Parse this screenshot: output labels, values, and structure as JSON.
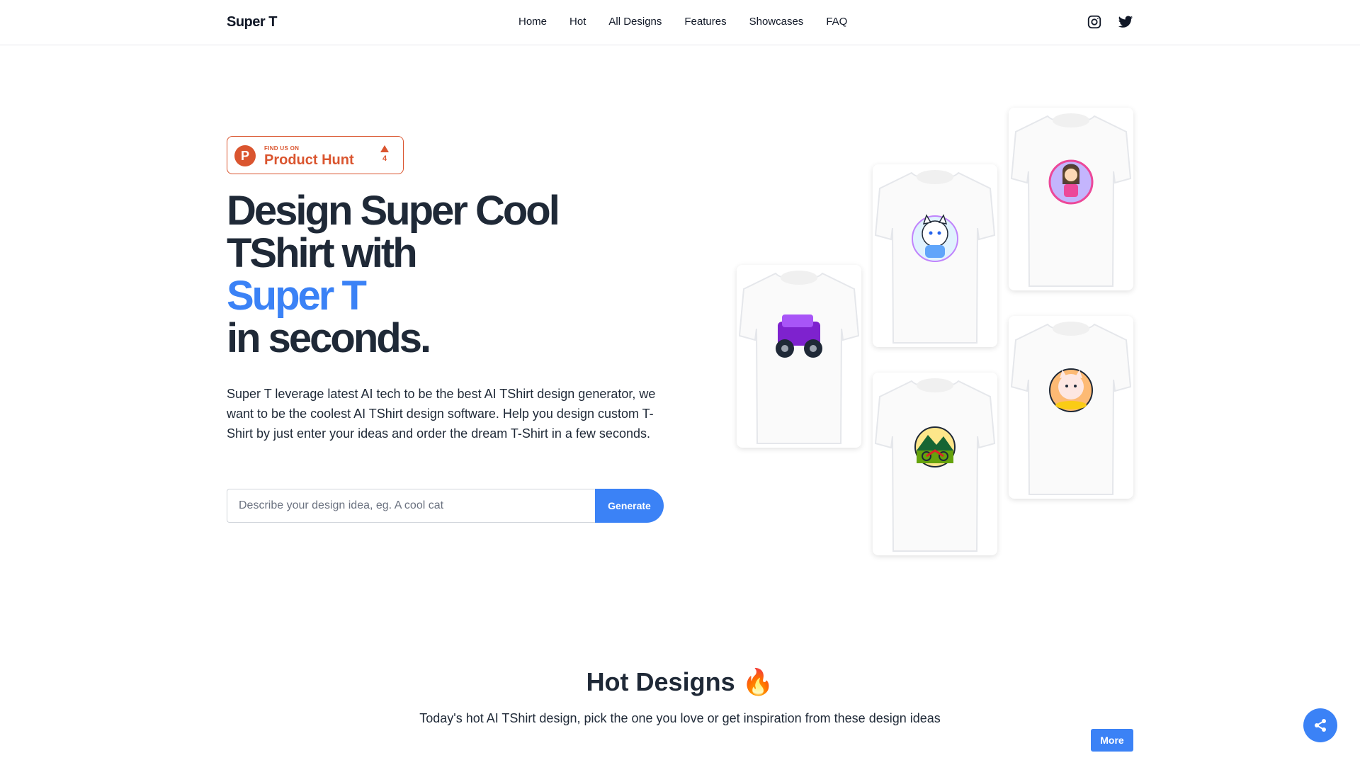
{
  "header": {
    "logo": "Super T",
    "nav": [
      "Home",
      "Hot",
      "All Designs",
      "Features",
      "Showcases",
      "FAQ"
    ],
    "social_icons": [
      "instagram-icon",
      "twitter-icon"
    ]
  },
  "product_hunt": {
    "small": "FIND US ON",
    "big": "Product Hunt",
    "votes": "4",
    "icon_letter": "P"
  },
  "hero": {
    "line1": "Design Super Cool",
    "line2": "TShirt with",
    "accent": "Super T",
    "line4": "in seconds.",
    "description": "Super T leverage latest AI tech to be the best AI TShirt design generator, we want to be the coolest AI TShirt design software. Help you design custom T-Shirt by just enter your ideas and order the dream T-Shirt in a few seconds."
  },
  "search": {
    "placeholder": "Describe your design idea, eg. A cool cat",
    "value": "",
    "button": "Generate"
  },
  "shirts": [
    "purple-monster-truck",
    "white-lucky-cat",
    "princess-girl",
    "motorcycle-mountain",
    "cat-badge"
  ],
  "hot": {
    "title": "Hot Designs 🔥",
    "subtitle": "Today's hot AI TShirt design, pick the one you love or get inspiration from these design ideas",
    "more": "More"
  },
  "colors": {
    "accent": "#3b82f6",
    "product_hunt": "#da552f",
    "text": "#1f2937"
  }
}
